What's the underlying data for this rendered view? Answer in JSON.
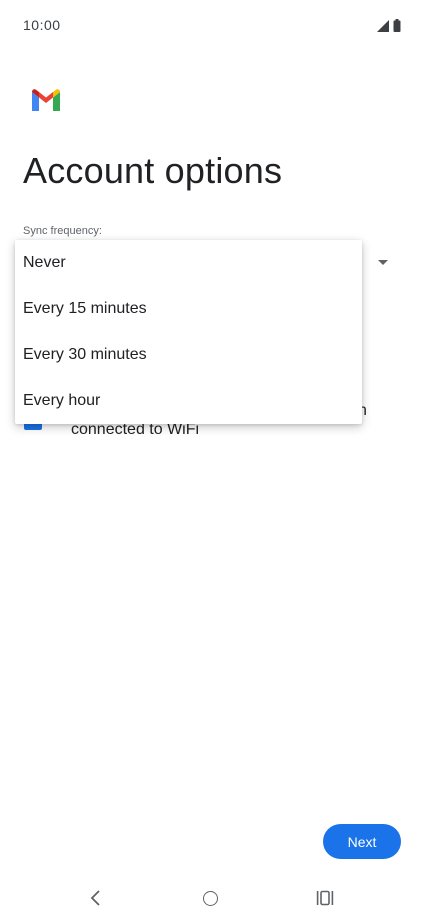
{
  "status_bar": {
    "time": "10:00",
    "signal_icon": "signal-icon",
    "battery_icon": "battery-icon"
  },
  "app": {
    "logo_icon": "gmail-logo-icon",
    "colors": {
      "accent": "#1a73e8",
      "red": "#ea4335",
      "yellow": "#fbbc04",
      "green": "#34a853",
      "blue": "#4285f4"
    }
  },
  "page": {
    "title": "Account options"
  },
  "sync": {
    "label": "Sync frequency:",
    "options": [
      "Never",
      "Every 15 minutes",
      "Every 30 minutes",
      "Every hour"
    ]
  },
  "wifi_option": {
    "checked": true,
    "text_tail": "n",
    "text": "connected to WiFi"
  },
  "buttons": {
    "next": "Next"
  },
  "nav": {
    "back_icon": "back-icon",
    "home_icon": "home-icon",
    "recent_icon": "recent-apps-icon"
  }
}
